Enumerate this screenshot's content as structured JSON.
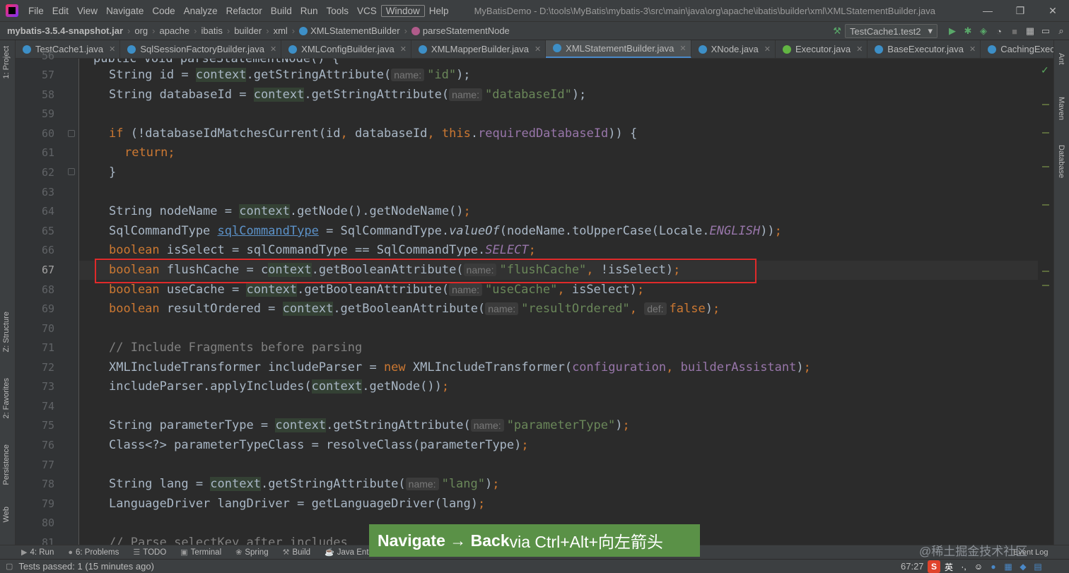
{
  "menubar": {
    "items": [
      "File",
      "Edit",
      "View",
      "Navigate",
      "Code",
      "Analyze",
      "Refactor",
      "Build",
      "Run",
      "Tools",
      "VCS",
      "Window",
      "Help"
    ],
    "window_title": "MyBatisDemo - D:\\tools\\MyBatis\\mybatis-3\\src\\main\\java\\org\\apache\\ibatis\\builder\\xml\\XMLStatementBuilder.java",
    "minimize": "—",
    "restore": "❐",
    "close": "✕"
  },
  "navbar": {
    "crumbs": [
      "mybatis-3.5.4-snapshot.jar",
      "org",
      "apache",
      "ibatis",
      "builder",
      "xml",
      "XMLStatementBuilder",
      "parseStatementNode"
    ],
    "run_config": "TestCache1.test2",
    "run_config_arrow": "▾"
  },
  "tabs": [
    {
      "label": "TestCache1.java",
      "color": "#3d8fc7"
    },
    {
      "label": "SqlSessionFactoryBuilder.java",
      "color": "#3d8fc7"
    },
    {
      "label": "XMLConfigBuilder.java",
      "color": "#3d8fc7"
    },
    {
      "label": "XMLMapperBuilder.java",
      "color": "#3d8fc7"
    },
    {
      "label": "XMLStatementBuilder.java",
      "color": "#3d8fc7"
    },
    {
      "label": "XNode.java",
      "color": "#3d8fc7"
    },
    {
      "label": "Executor.java",
      "color": "#62b543"
    },
    {
      "label": "BaseExecutor.java",
      "color": "#3d8fc7"
    },
    {
      "label": "CachingExecutor",
      "color": "#3d8fc7"
    }
  ],
  "left_strip": [
    "1: Project",
    "Z: Structure",
    "2: Favorites",
    "Persistence",
    "Web"
  ],
  "right_strip": [
    "Ant",
    "Maven",
    "Database"
  ],
  "line_numbers": [
    "56",
    "57",
    "58",
    "59",
    "60",
    "61",
    "62",
    "63",
    "64",
    "65",
    "66",
    "67",
    "68",
    "69",
    "70",
    "71",
    "72",
    "73",
    "74",
    "75",
    "76",
    "77",
    "78",
    "79",
    "80",
    "81"
  ],
  "code": {
    "l56": "public void parseStatementNode() {",
    "l57_a": "String id = ",
    "l57_ctx": "context",
    "l57_b": ".getStringAttribute(",
    "l57_hint": "name:",
    "l57_str": "\"id\"",
    "l57_c": ");",
    "l58_a": "String databaseId = ",
    "l58_ctx": "context",
    "l58_b": ".getStringAttribute(",
    "l58_hint": "name:",
    "l58_str": "\"databaseId\"",
    "l58_c": ");",
    "l60_kw": "if",
    "l60_a": " (!databaseIdMatchesCurrent(id",
    "l60_comma1": ",",
    "l60_b": " databaseId",
    "l60_comma2": ",",
    "l60_this": " this",
    "l60_c": ".",
    "l60_fld": "requiredDatabaseId",
    "l60_d": ")) {",
    "l61_kw": "return",
    "l61_semi": ";",
    "l62": "}",
    "l64_a": "String nodeName = ",
    "l64_ctx": "context",
    "l64_b": ".getNode().getNodeName()",
    "l64_semi": ";",
    "l65_a": "SqlCommandType ",
    "l65_ul": "sqlCommandType",
    "l65_b": " = SqlCommandType.",
    "l65_it": "valueOf",
    "l65_c": "(nodeName.toUpperCase(Locale.",
    "l65_fld": "ENGLISH",
    "l65_d": "))",
    "l65_semi": ";",
    "l66_kw": "boolean",
    "l66_a": " isSelect = sqlCommandType == SqlCommandType.",
    "l66_fld": "SELECT",
    "l66_semi": ";",
    "l67_kw": "boolean",
    "l67_a": " flushCache = c",
    "l67_ctx": "ontext",
    "l67_b": ".getBooleanAttribute(",
    "l67_hint": "name:",
    "l67_str": "\"flushCache\"",
    "l67_comma": ",",
    "l67_c": " !isSelect)",
    "l67_semi": ";",
    "l68_kw": "boolean",
    "l68_a": " useCache = ",
    "l68_ctx": "context",
    "l68_b": ".getBooleanAttribute(",
    "l68_hint": "name:",
    "l68_str": "\"useCache\"",
    "l68_comma": ",",
    "l68_c": " isSelect)",
    "l68_semi": ";",
    "l69_kw": "boolean",
    "l69_a": " resultOrdered = ",
    "l69_ctx": "context",
    "l69_b": ".getBooleanAttribute(",
    "l69_hint": "name:",
    "l69_str": "\"resultOrdered\"",
    "l69_comma": ",",
    "l69_hint2": "def:",
    "l69_kw2": "false",
    "l69_c": ")",
    "l69_semi": ";",
    "l71": "// Include Fragments before parsing",
    "l72_a": "XMLIncludeTransformer includeParser = ",
    "l72_kw": "new",
    "l72_b": " XMLIncludeTransformer(",
    "l72_fld1": "configuration",
    "l72_comma": ",",
    "l72_fld2": " builderAssistant",
    "l72_c": ")",
    "l72_semi": ";",
    "l73_a": "includeParser.applyIncludes(",
    "l73_ctx": "context",
    "l73_b": ".getNode())",
    "l73_semi": ";",
    "l75_a": "String parameterType = ",
    "l75_ctx": "context",
    "l75_b": ".getStringAttribute(",
    "l75_hint": "name:",
    "l75_str": "\"parameterType\"",
    "l75_c": ")",
    "l75_semi": ";",
    "l76_a": "Class<?> parameterTypeClass = resolveClass(parameterType)",
    "l76_semi": ";",
    "l78_a": "String lang = ",
    "l78_ctx": "context",
    "l78_b": ".getStringAttribute(",
    "l78_hint": "name:",
    "l78_str": "\"lang\"",
    "l78_c": ")",
    "l78_semi": ";",
    "l79_a": "LanguageDriver langDriver = getLanguageDriver(lang)",
    "l79_semi": ";",
    "l81": "// Parse selectKey after includes"
  },
  "tool_tabs": [
    {
      "icon": "▶",
      "label": "4: Run"
    },
    {
      "icon": "●",
      "label": "6: Problems"
    },
    {
      "icon": "☰",
      "label": "TODO"
    },
    {
      "icon": "▣",
      "label": "Terminal"
    },
    {
      "icon": "❀",
      "label": "Spring"
    },
    {
      "icon": "⚒",
      "label": "Build"
    },
    {
      "icon": "☕",
      "label": "Java Enterprise"
    }
  ],
  "status": {
    "text": "Tests passed: 1 (15 minutes ago)",
    "position": "67:27",
    "event_log": "Event Log"
  },
  "banner": {
    "action": "Navigate → Back",
    "rest": " via Ctrl+Alt+向左箭头"
  },
  "watermark": "@稀土掘金技术社区",
  "colors": {
    "accent_tab": "#4a88c7",
    "highlight_box": "#e02a2a",
    "banner_bg": "#5a9147",
    "run_green": "#59a869"
  }
}
